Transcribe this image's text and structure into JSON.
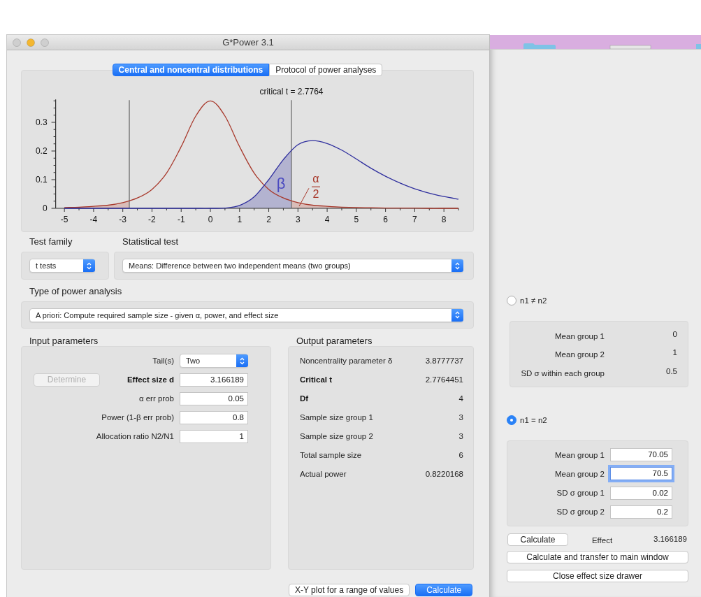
{
  "window": {
    "title": "G*Power 3.1"
  },
  "tabs": [
    {
      "label": "Central and noncentral distributions",
      "selected": true
    },
    {
      "label": "Protocol of power analyses",
      "selected": false
    }
  ],
  "distribution_plot": {
    "chart_data": {
      "type": "line",
      "x": [
        -5,
        -4.5,
        -4,
        -3.5,
        -3,
        -2.5,
        -2,
        -1.5,
        -1,
        -0.5,
        0,
        0.5,
        1,
        1.5,
        2,
        2.5,
        3,
        3.5,
        4,
        4.5,
        5,
        5.5,
        6,
        6.5,
        7,
        7.5,
        8,
        8.5
      ],
      "series": [
        {
          "color": "#a8392c",
          "values": [
            0.003,
            0.004,
            0.007,
            0.011,
            0.02,
            0.036,
            0.066,
            0.123,
            0.215,
            0.322,
            0.375,
            0.322,
            0.215,
            0.123,
            0.066,
            0.036,
            0.02,
            0.011,
            0.007,
            0.004,
            0.003,
            0.002,
            0.001,
            0.001,
            0.001,
            0,
            0,
            0
          ]
        },
        {
          "color": "#2f2f9e",
          "values": [
            0,
            0,
            0,
            0,
            0,
            0,
            0,
            0,
            0,
            0,
            0,
            0.001,
            0.01,
            0.04,
            0.1,
            0.17,
            0.222,
            0.236,
            0.226,
            0.203,
            0.172,
            0.14,
            0.112,
            0.088,
            0.068,
            0.053,
            0.041,
            0.032
          ]
        }
      ],
      "xlim": [
        -5.3,
        8.5
      ],
      "ylim": [
        0,
        0.38
      ],
      "xticks": [
        -5,
        -4,
        -3,
        -2,
        -1,
        0,
        1,
        2,
        3,
        4,
        5,
        6,
        7,
        8
      ],
      "yticks": [
        0,
        0.1,
        0.2,
        0.3
      ],
      "ref_lines": [
        {
          "axis": "x",
          "value": -2.7764
        },
        {
          "axis": "x",
          "value": 2.7764
        }
      ],
      "annotations": [
        "critical t = 2.7764",
        "β",
        "α",
        "2"
      ]
    }
  },
  "test_family": {
    "label": "Test family",
    "value": "t tests"
  },
  "statistical_test": {
    "label": "Statistical test",
    "value": "Means: Difference between two independent means (two groups)"
  },
  "power_analysis_type": {
    "label": "Type of power analysis",
    "value": "A priori: Compute required sample size - given α, power, and effect size"
  },
  "input_parameters": {
    "title": "Input parameters",
    "determine_button": {
      "label": "Determine",
      "disabled": true
    },
    "rows": [
      {
        "kind": "popup",
        "label": "Tail(s)",
        "value": "Two",
        "highlighted": false
      },
      {
        "kind": "field",
        "label": "Effect size d",
        "value": "3.166189",
        "highlighted": true
      },
      {
        "kind": "field",
        "label": "α err prob",
        "value": "0.05",
        "highlighted": false
      },
      {
        "kind": "field",
        "label": "Power (1-β err prob)",
        "value": "0.8",
        "highlighted": false
      },
      {
        "kind": "field",
        "label": "Allocation ratio N2/N1",
        "value": "1",
        "highlighted": false
      }
    ]
  },
  "output_parameters": {
    "title": "Output parameters",
    "rows": [
      {
        "label": "Noncentrality parameter δ",
        "value": "3.8777737",
        "highlighted": false
      },
      {
        "label": "Critical t",
        "value": "2.7764451",
        "highlighted": true
      },
      {
        "label": "Df",
        "value": "4",
        "highlighted": true
      },
      {
        "label": "Sample size group 1",
        "value": "3",
        "highlighted": false
      },
      {
        "label": "Sample size group 2",
        "value": "3",
        "highlighted": false
      },
      {
        "label": "Total sample size",
        "value": "6",
        "highlighted": false
      },
      {
        "label": "Actual power",
        "value": "0.8220168",
        "highlighted": false
      }
    ]
  },
  "buttons": [
    {
      "label": "X-Y plot for a range of values",
      "default": false
    },
    {
      "label": "Calculate",
      "default": true
    }
  ],
  "effect_size_drawer": {
    "options": [
      {
        "label": "n1 ≠ n2",
        "selected": false,
        "rows": [
          {
            "kind": "text",
            "label": "Mean group 1",
            "value": "0"
          },
          {
            "kind": "text",
            "label": "Mean group 2",
            "value": "1"
          },
          {
            "kind": "text",
            "label": "SD σ within each group",
            "value": "0.5"
          }
        ]
      },
      {
        "label": "n1 = n2",
        "selected": true,
        "rows": [
          {
            "kind": "field",
            "label": "Mean group 1",
            "value": "70.05",
            "focused": false
          },
          {
            "kind": "field",
            "label": "Mean group 2",
            "value": "70.5",
            "focused": true
          },
          {
            "kind": "field",
            "label": "SD σ group 1",
            "value": "0.02",
            "focused": false
          },
          {
            "kind": "field",
            "label": "SD σ group 2",
            "value": "0.2",
            "focused": false
          }
        ]
      }
    ],
    "calculate_button": "Calculate",
    "effect_label": "Effect",
    "effect_value": "3.166189",
    "buttons": [
      "Calculate and transfer to main window",
      "Close effect size drawer"
    ]
  }
}
